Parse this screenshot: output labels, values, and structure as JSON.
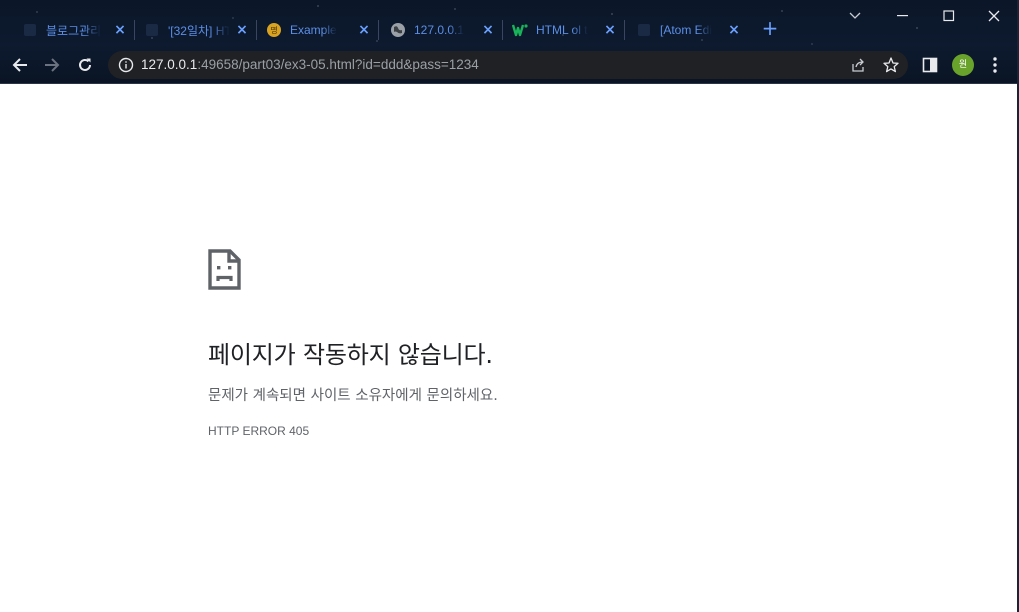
{
  "tabs": [
    {
      "title": "블로그관리",
      "favicon": "blog-favicon",
      "close": "×"
    },
    {
      "title": "'[32일차] HTML",
      "favicon": "page-favicon",
      "close": "×"
    },
    {
      "title": "Example",
      "favicon": "korean-favicon",
      "favicon_text": "명",
      "close": "×"
    },
    {
      "title": "127.0.0.1",
      "favicon": "globe-favicon",
      "close": "×"
    },
    {
      "title": "HTML ol t",
      "favicon": "w-favicon",
      "close": "×"
    },
    {
      "title": "[Atom Edi",
      "favicon": "page-favicon",
      "close": "×"
    }
  ],
  "new_tab": "+",
  "address_bar": {
    "host": "127.0.0.1",
    "rest": ":49658/part03/ex3-05.html?id=ddd&pass=1234"
  },
  "profile": {
    "initial": "원",
    "color": "#6aa32b"
  },
  "error_page": {
    "title": "페이지가 작동하지 않습니다.",
    "description": "문제가 계속되면 사이트 소유자에게 문의하세요.",
    "code": "HTTP ERROR 405"
  },
  "colors": {
    "tab_text": "#5b8fe8",
    "chrome_bg": "#0b1628",
    "omnibox_bg": "#202124"
  }
}
